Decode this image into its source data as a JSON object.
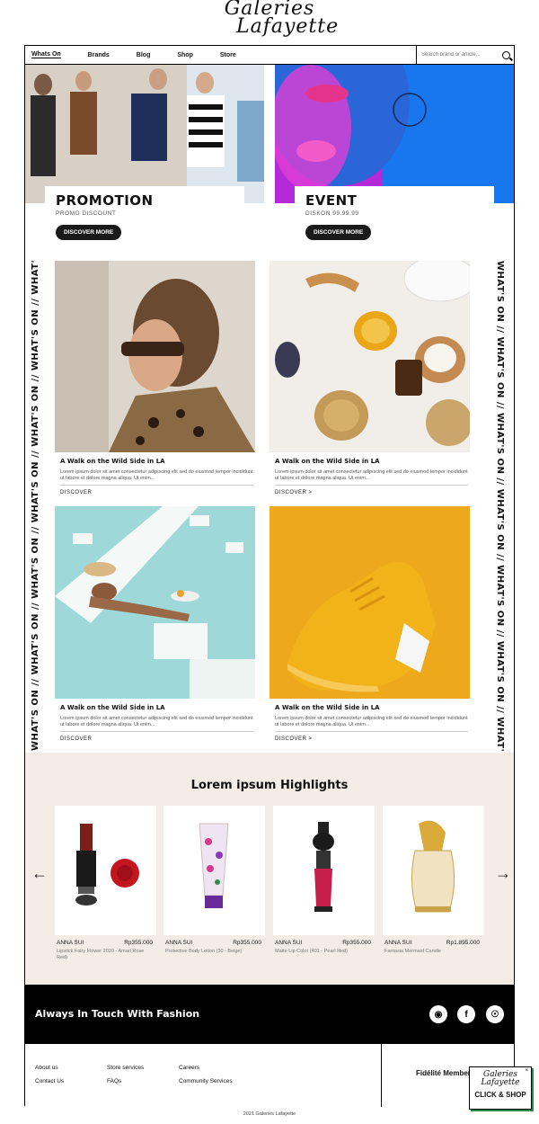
{
  "header": {
    "logo_line1": "Galeries",
    "logo_line2": "Lafayette",
    "nav": [
      "Whats On",
      "Brands",
      "Blog",
      "Shop",
      "Store"
    ],
    "search_placeholder": "Search brand or article..."
  },
  "promos": [
    {
      "title": "PROMOTION",
      "subtitle": "PROMO DISCOUNT",
      "button": "DISCOVER MORE"
    },
    {
      "title": "EVENT",
      "subtitle": "DISKON 99.99.99",
      "button": "DISCOVER MORE"
    }
  ],
  "vertical_text": "WHAT'S ON // WHAT'S ON // WHAT'S ON // WHAT'S ON // WHAT'S ON // WHAT'S ON // WHAT'S ON // WHAT'S O",
  "articles": [
    {
      "title": "A Walk on the Wild Side in LA",
      "desc": "Lorem ipsum dolor sit amet consectetur adipiscing elit sed do eiusmod tempor incididunt ut labore et dolore magna aliqua. Ut enim...",
      "link": "DISCOVER"
    },
    {
      "title": "A Walk on the Wild Side in LA",
      "desc": "Lorem ipsum dolor sit amet consectetur adipiscing elit sed do eiusmod tempor incididunt ut labore et dolore magna aliqua. Ut enim...",
      "link": "DISCOVER  >"
    },
    {
      "title": "A Walk on the Wild Side in LA",
      "desc": "Lorem ipsum dolor sit amet consectetur adipiscing elit sed do eiusmod tempor incididunt ut labore et dolore magna aliqua. Ut enim...",
      "link": "DISCOVER"
    },
    {
      "title": "A Walk on the Wild Side in LA",
      "desc": "Lorem ipsum dolor sit amet consectetur adipiscing elit sed do eiusmod tempor incididunt ut labore et dolore magna aliqua. Ut enim...",
      "link": "DISCOVER  >"
    }
  ],
  "highlights": {
    "title": "Lorem ipsum Highlights",
    "products": [
      {
        "brand": "ANNA SUI",
        "price": "Rp355.000",
        "name": "Lipstick Fairy Flower 2020 - Amari Rose Red)"
      },
      {
        "brand": "ANNA SUI",
        "price": "Rp355.000",
        "name": "Protective Body Lotion (30 - Beige)"
      },
      {
        "brand": "ANNA SUI",
        "price": "Rp355.000",
        "name": "Matte Lip Color (401 - Pearl Red)"
      },
      {
        "brand": "ANNA SUI",
        "price": "Rp1.895.000",
        "name": "Fantasia Mermaid Candle"
      }
    ]
  },
  "footer": {
    "touch": "Always In Touch With Fashion",
    "col1": [
      "About us",
      "Contact Us"
    ],
    "col2": [
      "Store services",
      "FAQs"
    ],
    "col3": [
      "Careers",
      "Community Services"
    ],
    "fidelite": "Fidélité Members",
    "copyright": "2021 Galeries Lafayette",
    "click_shop": "CLICK & SHOP",
    "click_shop_logo1": "Galeries",
    "click_shop_logo2": "Lafayette"
  }
}
